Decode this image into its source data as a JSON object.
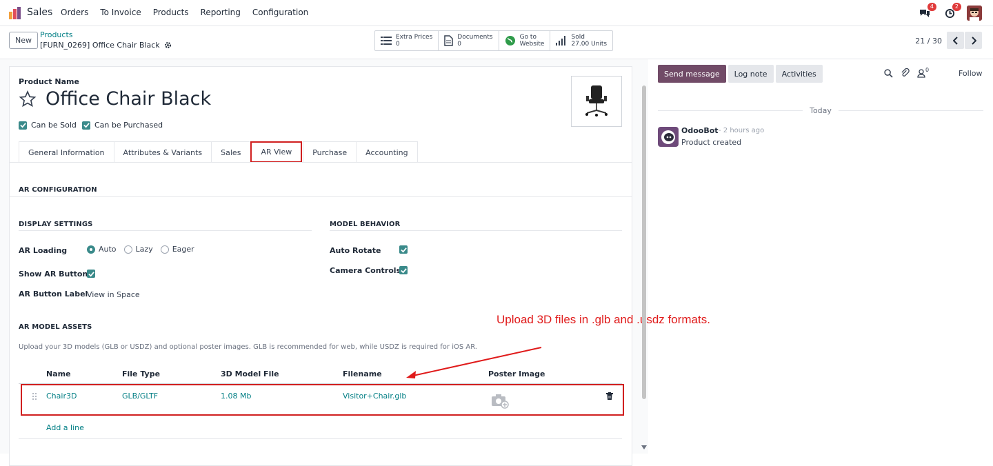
{
  "nav": {
    "app_name": "Sales",
    "menu": [
      "Orders",
      "To Invoice",
      "Products",
      "Reporting",
      "Configuration"
    ],
    "messages_count": "4",
    "activities_count": "2"
  },
  "control_panel": {
    "new_label": "New",
    "breadcrumb": "Products",
    "record_title": "[FURN_0269] Office Chair Black",
    "smart_buttons": [
      {
        "icon": "list-icon",
        "line1": "Extra Prices",
        "line2": "0"
      },
      {
        "icon": "document-icon",
        "line1": "Documents",
        "line2": "0"
      },
      {
        "icon": "globe-icon",
        "line1": "Go to",
        "line2": "Website"
      },
      {
        "icon": "bar-chart-icon",
        "line1": "Sold",
        "line2": "27.00 Units"
      }
    ],
    "pager": "21 / 30"
  },
  "form": {
    "product_name_label": "Product Name",
    "product_name": "Office Chair Black",
    "can_be_sold": "Can be Sold",
    "can_be_purchased": "Can be Purchased",
    "tabs": [
      "General Information",
      "Attributes & Variants",
      "Sales",
      "AR View",
      "Purchase",
      "Accounting"
    ],
    "active_tab": "AR View",
    "ar_configuration": "AR CONFIGURATION",
    "display_settings": "DISPLAY SETTINGS",
    "model_behavior": "MODEL BEHAVIOR",
    "ar_loading_label": "AR Loading",
    "ar_loading_options": [
      "Auto",
      "Lazy",
      "Eager"
    ],
    "ar_loading_selected": "Auto",
    "show_ar_button_label": "Show AR Button",
    "ar_button_label_label": "AR Button Label",
    "ar_button_label_value": "View in Space",
    "auto_rotate_label": "Auto Rotate",
    "camera_controls_label": "Camera Controls",
    "ar_model_assets": "AR MODEL ASSETS",
    "assets_description": "Upload your 3D models (GLB or USDZ) and optional poster images. GLB is recommended for web, while USDZ is required for iOS AR.",
    "table_headers": [
      "Name",
      "File Type",
      "3D Model File",
      "Filename",
      "Poster Image"
    ],
    "rows": [
      {
        "name": "Chair3D",
        "file_type": "GLB/GLTF",
        "model_file": "1.08 Mb",
        "filename": "Visitor+Chair.glb"
      }
    ],
    "add_line": "Add a line",
    "annotation": "Upload 3D files in .glb and .usdz formats."
  },
  "chatter": {
    "send_message": "Send message",
    "log_note": "Log note",
    "activities": "Activities",
    "followers_count": "0",
    "follow": "Follow",
    "today": "Today",
    "author": "OdooBot",
    "time": "- 2 hours ago",
    "body": "Product created"
  },
  "colors": {
    "accent": "#714b67",
    "teal": "#017e84",
    "highlight": "#d01f1f"
  }
}
